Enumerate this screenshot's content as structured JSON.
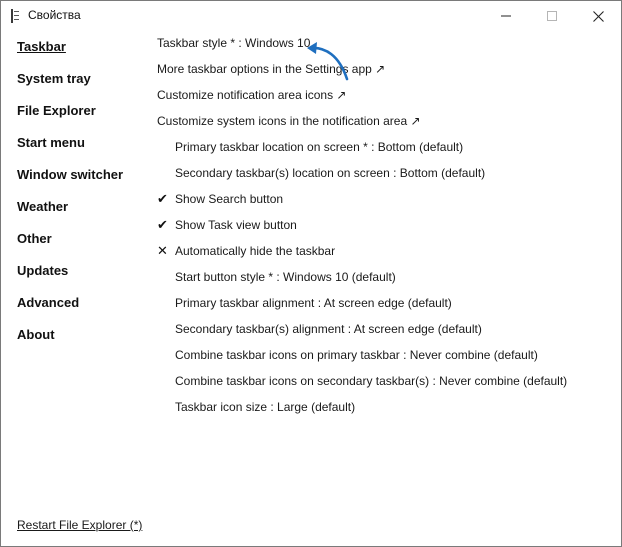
{
  "window": {
    "title": "Свойства",
    "controls": [
      "minimize-icon",
      "maximize-icon",
      "close-icon"
    ]
  },
  "sidebar": {
    "items": [
      {
        "label": "Taskbar",
        "active": true
      },
      {
        "label": "System tray"
      },
      {
        "label": "File Explorer"
      },
      {
        "label": "Start menu"
      },
      {
        "label": "Window switcher"
      },
      {
        "label": "Weather"
      },
      {
        "label": "Other"
      },
      {
        "label": "Updates"
      },
      {
        "label": "Advanced"
      },
      {
        "label": "About"
      }
    ],
    "restart_label": "Restart File Explorer (*)"
  },
  "settings": {
    "items": [
      {
        "label": "Taskbar style * : Windows 10"
      },
      {
        "label": "More taskbar options in the Settings app ↗"
      },
      {
        "label": "Customize notification area icons ↗"
      },
      {
        "label": "Customize system icons in the notification area ↗"
      },
      {
        "label": "Primary taskbar location on screen * : Bottom (default)"
      },
      {
        "label": "Secondary taskbar(s) location on screen : Bottom (default)"
      },
      {
        "label": "Show Search button",
        "mark": "✔"
      },
      {
        "label": "Show Task view button",
        "mark": "✔"
      },
      {
        "label": "Automatically hide the taskbar",
        "mark": "✕"
      },
      {
        "label": "Start button style * : Windows 10 (default)"
      },
      {
        "label": "Primary taskbar alignment : At screen edge (default)"
      },
      {
        "label": "Secondary taskbar(s) alignment : At screen edge (default)"
      },
      {
        "label": "Combine taskbar icons on primary taskbar : Never combine (default)"
      },
      {
        "label": "Combine taskbar icons on secondary taskbar(s) : Never combine (default)"
      },
      {
        "label": "Taskbar icon size : Large (default)"
      }
    ]
  },
  "colors": {
    "annotation_arrow": "#1f6fbf",
    "text": "#1a1a1a",
    "border": "#7a7a7a"
  }
}
